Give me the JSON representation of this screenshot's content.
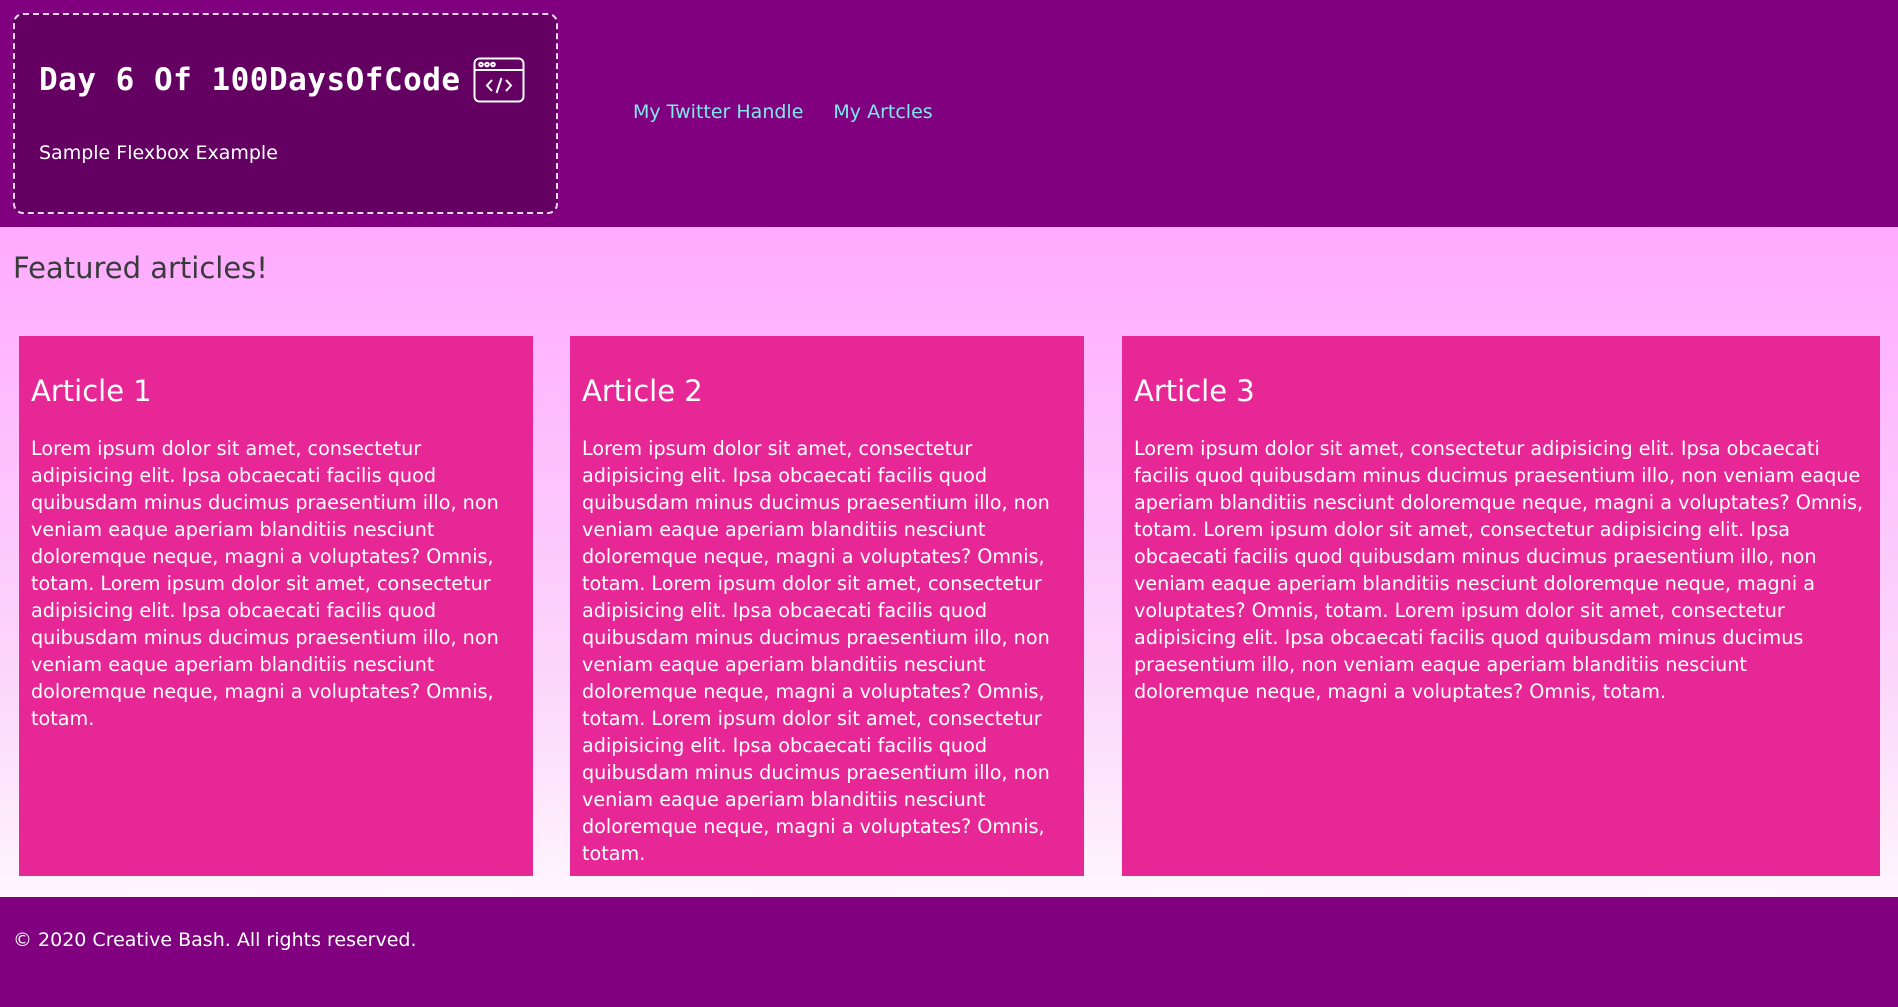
{
  "header": {
    "title": "Day 6 Of 100DaysOfCode",
    "icon": "code-window-icon",
    "subtitle": "Sample Flexbox Example",
    "nav": [
      {
        "label": "My Twitter Handle"
      },
      {
        "label": "My Artcles"
      }
    ]
  },
  "main": {
    "section_title": "Featured articles!",
    "articles": [
      {
        "title": "Article 1",
        "body": "Lorem ipsum dolor sit amet, consectetur adipisicing elit. Ipsa obcaecati facilis quod quibusdam minus ducimus praesentium illo, non veniam eaque aperiam blanditiis nesciunt doloremque neque, magni a voluptates? Omnis, totam. Lorem ipsum dolor sit amet, consectetur adipisicing elit. Ipsa obcaecati facilis quod quibusdam minus ducimus praesentium illo, non veniam eaque aperiam blanditiis nesciunt doloremque neque, magni a voluptates? Omnis, totam."
      },
      {
        "title": "Article 2",
        "body": "Lorem ipsum dolor sit amet, consectetur adipisicing elit. Ipsa obcaecati facilis quod quibusdam minus ducimus praesentium illo, non veniam eaque aperiam blanditiis nesciunt doloremque neque, magni a voluptates? Omnis, totam. Lorem ipsum dolor sit amet, consectetur adipisicing elit. Ipsa obcaecati facilis quod quibusdam minus ducimus praesentium illo, non veniam eaque aperiam blanditiis nesciunt doloremque neque, magni a voluptates? Omnis, totam. Lorem ipsum dolor sit amet, consectetur adipisicing elit. Ipsa obcaecati facilis quod quibusdam minus ducimus praesentium illo, non veniam eaque aperiam blanditiis nesciunt doloremque neque, magni a voluptates? Omnis, totam."
      },
      {
        "title": "Article 3",
        "body": "Lorem ipsum dolor sit amet, consectetur adipisicing elit. Ipsa obcaecati facilis quod quibusdam minus ducimus praesentium illo, non veniam eaque aperiam blanditiis nesciunt doloremque neque, magni a voluptates? Omnis, totam. Lorem ipsum dolor sit amet, consectetur adipisicing elit. Ipsa obcaecati facilis quod quibusdam minus ducimus praesentium illo, non veniam eaque aperiam blanditiis nesciunt doloremque neque, magni a voluptates? Omnis, totam. Lorem ipsum dolor sit amet, consectetur adipisicing elit. Ipsa obcaecati facilis quod quibusdam minus ducimus praesentium illo, non veniam eaque aperiam blanditiis nesciunt doloremque neque, magni a voluptates? Omnis, totam."
      }
    ]
  },
  "footer": {
    "copyright": "© 2020 Creative Bash. All rights reserved."
  },
  "colors": {
    "header_bg": "#800080",
    "brand_box_bg": "#640062",
    "nav_link": "#7fe8e8",
    "main_bg_top": "#ffaaff",
    "article_bg": "#e82796",
    "footer_bg": "#800080"
  }
}
